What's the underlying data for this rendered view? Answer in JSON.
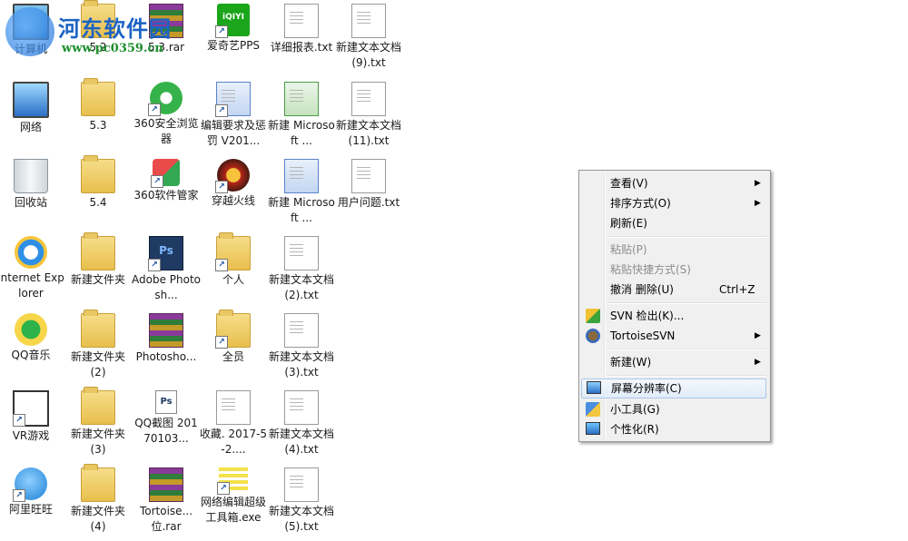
{
  "watermark": {
    "title": "河东软件园",
    "url": "www.pc0359.cn"
  },
  "desktop_icons": {
    "computer": "计算机",
    "folder_52": "5.2",
    "rar_53": "5.3.rar",
    "iqiyi": "爱奇艺PPS",
    "report": "详细报表.txt",
    "newtxt9": "新建文本文档 (9).txt",
    "network": "网络",
    "folder_53": "5.3",
    "browser360": "360安全浏览器",
    "edit_req": "编辑要求及惩罚 V201...",
    "new_ms_excel": "新建 Microsoft ...",
    "newtxt11": "新建文本文档 (11).txt",
    "recycle": "回收站",
    "folder_54": "5.4",
    "mgr360": "360软件管家",
    "cf": "穿越火线",
    "new_ms_word": "新建 Microsoft ...",
    "userq": "用户问题.txt",
    "ie": "Internet Explorer",
    "newfolder": "新建文件夹",
    "adobe_ps": "Adobe Photosh...",
    "personal": "个人",
    "newtxt2": "新建文本文档 (2).txt",
    "qqmusic": "QQ音乐",
    "newfolder2": "新建文件夹 (2)",
    "photosho": "Photosho...",
    "allmembers": "全员",
    "newtxt3": "新建文本文档 (3).txt",
    "vrgame": "VR游戏",
    "newfolder3": "新建文件夹 (3)",
    "qqshot": "QQ截图 20170103...",
    "favorite": "收藏. 2017-5-2....",
    "newtxt4": "新建文本文档 (4).txt",
    "aliwangwang": "阿里旺旺",
    "newfolder4": "新建文件夹 (4)",
    "tortoise_rar": "Tortoise... 位.rar",
    "netedit": "网络编辑超级工具箱.exe",
    "newtxt5": "新建文本文档 (5).txt"
  },
  "context_menu": {
    "view": "查看(V)",
    "sort": "排序方式(O)",
    "refresh": "刷新(E)",
    "paste": "粘贴(P)",
    "paste_shortcut": "粘贴快捷方式(S)",
    "undo_delete": "撤消 删除(U)",
    "undo_shortcut": "Ctrl+Z",
    "svn_checkout": "SVN 检出(K)...",
    "tortoise_svn": "TortoiseSVN",
    "new": "新建(W)",
    "resolution": "屏幕分辨率(C)",
    "gadgets": "小工具(G)",
    "personalize": "个性化(R)",
    "submenu_arrow": "▶"
  }
}
